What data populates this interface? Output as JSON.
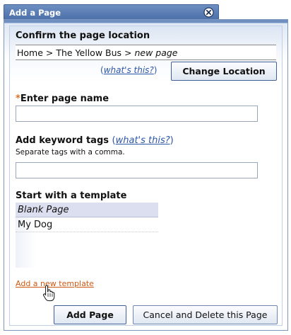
{
  "dialog": {
    "title": "Add a Page"
  },
  "location": {
    "heading": "Confirm the page location",
    "path_prefix": "Home > The Yellow Bus > ",
    "path_current": "new page",
    "whats_this": "what's this?",
    "change_button": "Change Location"
  },
  "page_name": {
    "required_mark": "*",
    "label": "Enter page name",
    "value": ""
  },
  "keywords": {
    "label": "Add keyword tags",
    "whats_this": "what's this?",
    "hint": "Separate tags with a comma.",
    "value": ""
  },
  "template": {
    "label": "Start with a template",
    "items": [
      "Blank Page",
      "My Dog"
    ],
    "selected_index": 0,
    "add_link": "Add a new template"
  },
  "footer": {
    "add_button": "Add Page",
    "cancel_button": "Cancel and Delete this Page"
  },
  "colors": {
    "titlebar": "#4a6ea8",
    "link": "#2e56a8",
    "add_template_link": "#d05a14",
    "required": "#e07020",
    "selected_row": "#dcdff0"
  },
  "icons": {
    "close": "close-circle-icon",
    "cursor": "hand-pointer-icon"
  }
}
